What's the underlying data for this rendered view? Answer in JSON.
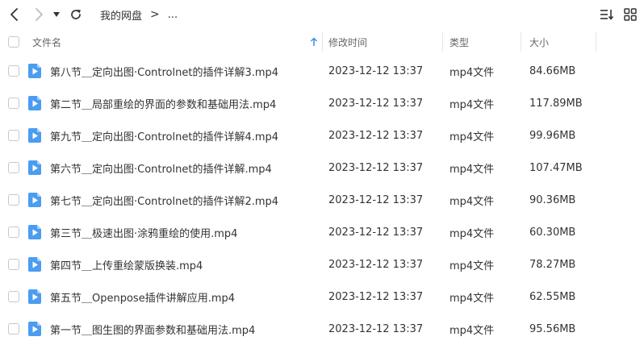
{
  "breadcrumb": {
    "root": "我的网盘",
    "separator": ">",
    "more": "..."
  },
  "header": {
    "name": "文件名",
    "modified": "修改时间",
    "type": "类型",
    "size": "大小"
  },
  "colors": {
    "accent": "#3a8ee6",
    "icon_fill": "#4a9df0"
  },
  "files": [
    {
      "name": "第八节＿定向出图·Controlnet的插件详解3.mp4",
      "modified": "2023-12-12 13:37",
      "type": "mp4文件",
      "size": "84.66MB"
    },
    {
      "name": "第二节＿局部重绘的界面的参数和基础用法.mp4",
      "modified": "2023-12-12 13:37",
      "type": "mp4文件",
      "size": "117.89MB"
    },
    {
      "name": "第九节＿定向出图·Controlnet的插件详解4.mp4",
      "modified": "2023-12-12 13:37",
      "type": "mp4文件",
      "size": "99.96MB"
    },
    {
      "name": "第六节＿定向出图·Controlnet的插件详解.mp4",
      "modified": "2023-12-12 13:37",
      "type": "mp4文件",
      "size": "107.47MB"
    },
    {
      "name": "第七节＿定向出图·Controlnet的插件详解2.mp4",
      "modified": "2023-12-12 13:37",
      "type": "mp4文件",
      "size": "90.36MB"
    },
    {
      "name": "第三节＿极速出图·涂鸦重绘的使用.mp4",
      "modified": "2023-12-12 13:37",
      "type": "mp4文件",
      "size": "60.30MB"
    },
    {
      "name": "第四节＿上传重绘蒙版换装.mp4",
      "modified": "2023-12-12 13:37",
      "type": "mp4文件",
      "size": "78.27MB"
    },
    {
      "name": "第五节＿Openpose插件讲解应用.mp4",
      "modified": "2023-12-12 13:37",
      "type": "mp4文件",
      "size": "62.55MB"
    },
    {
      "name": "第一节＿图生图的界面参数和基础用法.mp4",
      "modified": "2023-12-12 13:37",
      "type": "mp4文件",
      "size": "95.56MB"
    }
  ]
}
